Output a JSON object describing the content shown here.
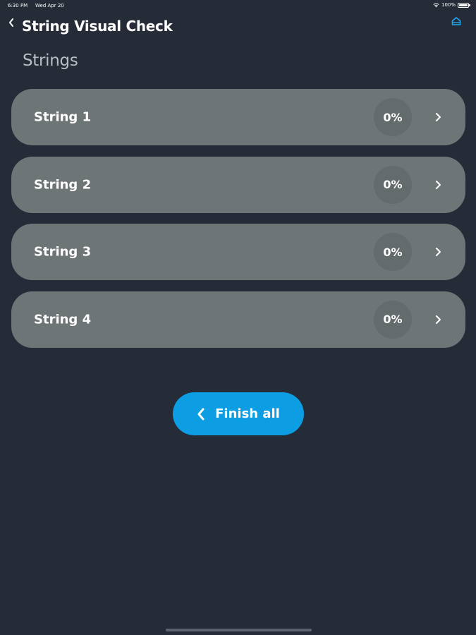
{
  "status_bar": {
    "time": "6:30 PM",
    "date": "Wed Apr 20",
    "battery": "100%"
  },
  "header": {
    "title": "String Visual Check",
    "back_icon": "chevron-left-icon",
    "home_icon": "home-icon"
  },
  "section": {
    "title": "Strings"
  },
  "strings": [
    {
      "label": "String 1",
      "progress": "0%"
    },
    {
      "label": "String 2",
      "progress": "0%"
    },
    {
      "label": "String 3",
      "progress": "0%"
    },
    {
      "label": "String 4",
      "progress": "0%"
    }
  ],
  "finish_button": {
    "label": "Finish all"
  },
  "colors": {
    "background": "#252b37",
    "item_background": "#6e7577",
    "badge_background": "#636b6d",
    "accent": "#0d9de3",
    "home_icon": "#1ea8f0"
  }
}
